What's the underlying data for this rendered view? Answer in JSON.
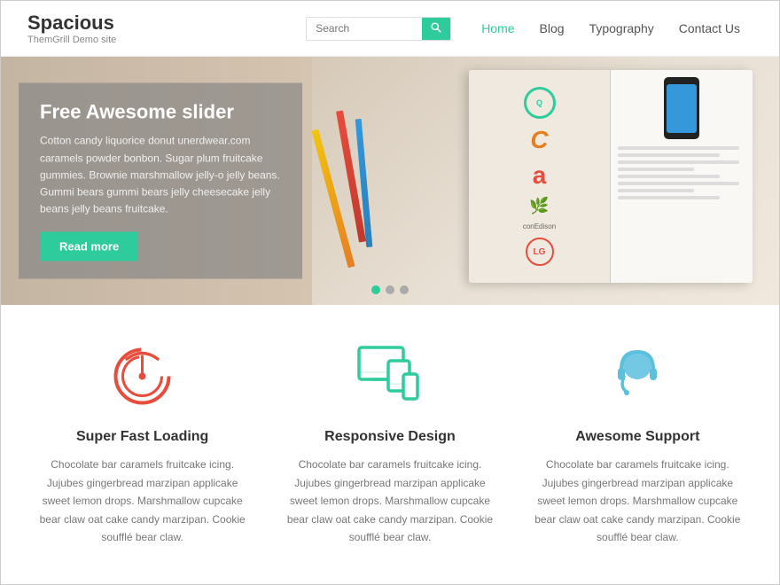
{
  "site": {
    "title": "Spacious",
    "tagline": "ThemGrill Demo site"
  },
  "header": {
    "search_placeholder": "Search",
    "search_btn_label": "🔍",
    "nav": [
      {
        "label": "Home",
        "active": true
      },
      {
        "label": "Blog",
        "active": false
      },
      {
        "label": "Typography",
        "active": false
      },
      {
        "label": "Contact Us",
        "active": false
      }
    ]
  },
  "hero": {
    "title": "Free Awesome slider",
    "body": "Cotton candy liquorice donut unerdwear.com caramels powder bonbon. Sugar plum fruitcake gummies. Brownie marshmallow jelly-o jelly beans. Gummi bears gummi bears jelly cheesecake jelly beans jelly beans fruitcake.",
    "read_more": "Read more",
    "dots": [
      {
        "active": true
      },
      {
        "active": false
      },
      {
        "active": false
      }
    ]
  },
  "features": [
    {
      "id": "speed",
      "title": "Super Fast Loading",
      "desc": "Chocolate bar caramels fruitcake icing. Jujubes gingerbread marzipan applicake sweet lemon drops. Marshmallow cupcake bear claw oat cake candy marzipan. Cookie soufflé bear claw.",
      "icon_color": "#e74c3c"
    },
    {
      "id": "responsive",
      "title": "Responsive Design",
      "desc": "Chocolate bar caramels fruitcake icing. Jujubes gingerbread marzipan applicake sweet lemon drops. Marshmallow cupcake bear claw oat cake candy marzipan. Cookie soufflé bear claw.",
      "icon_color": "#2ecc9c"
    },
    {
      "id": "support",
      "title": "Awesome Support",
      "desc": "Chocolate bar caramels fruitcake icing. Jujubes gingerbread marzipan applicake sweet lemon drops. Marshmallow cupcake bear claw oat cake candy marzipan. Cookie soufflé bear claw.",
      "icon_color": "#5bc0de"
    }
  ]
}
